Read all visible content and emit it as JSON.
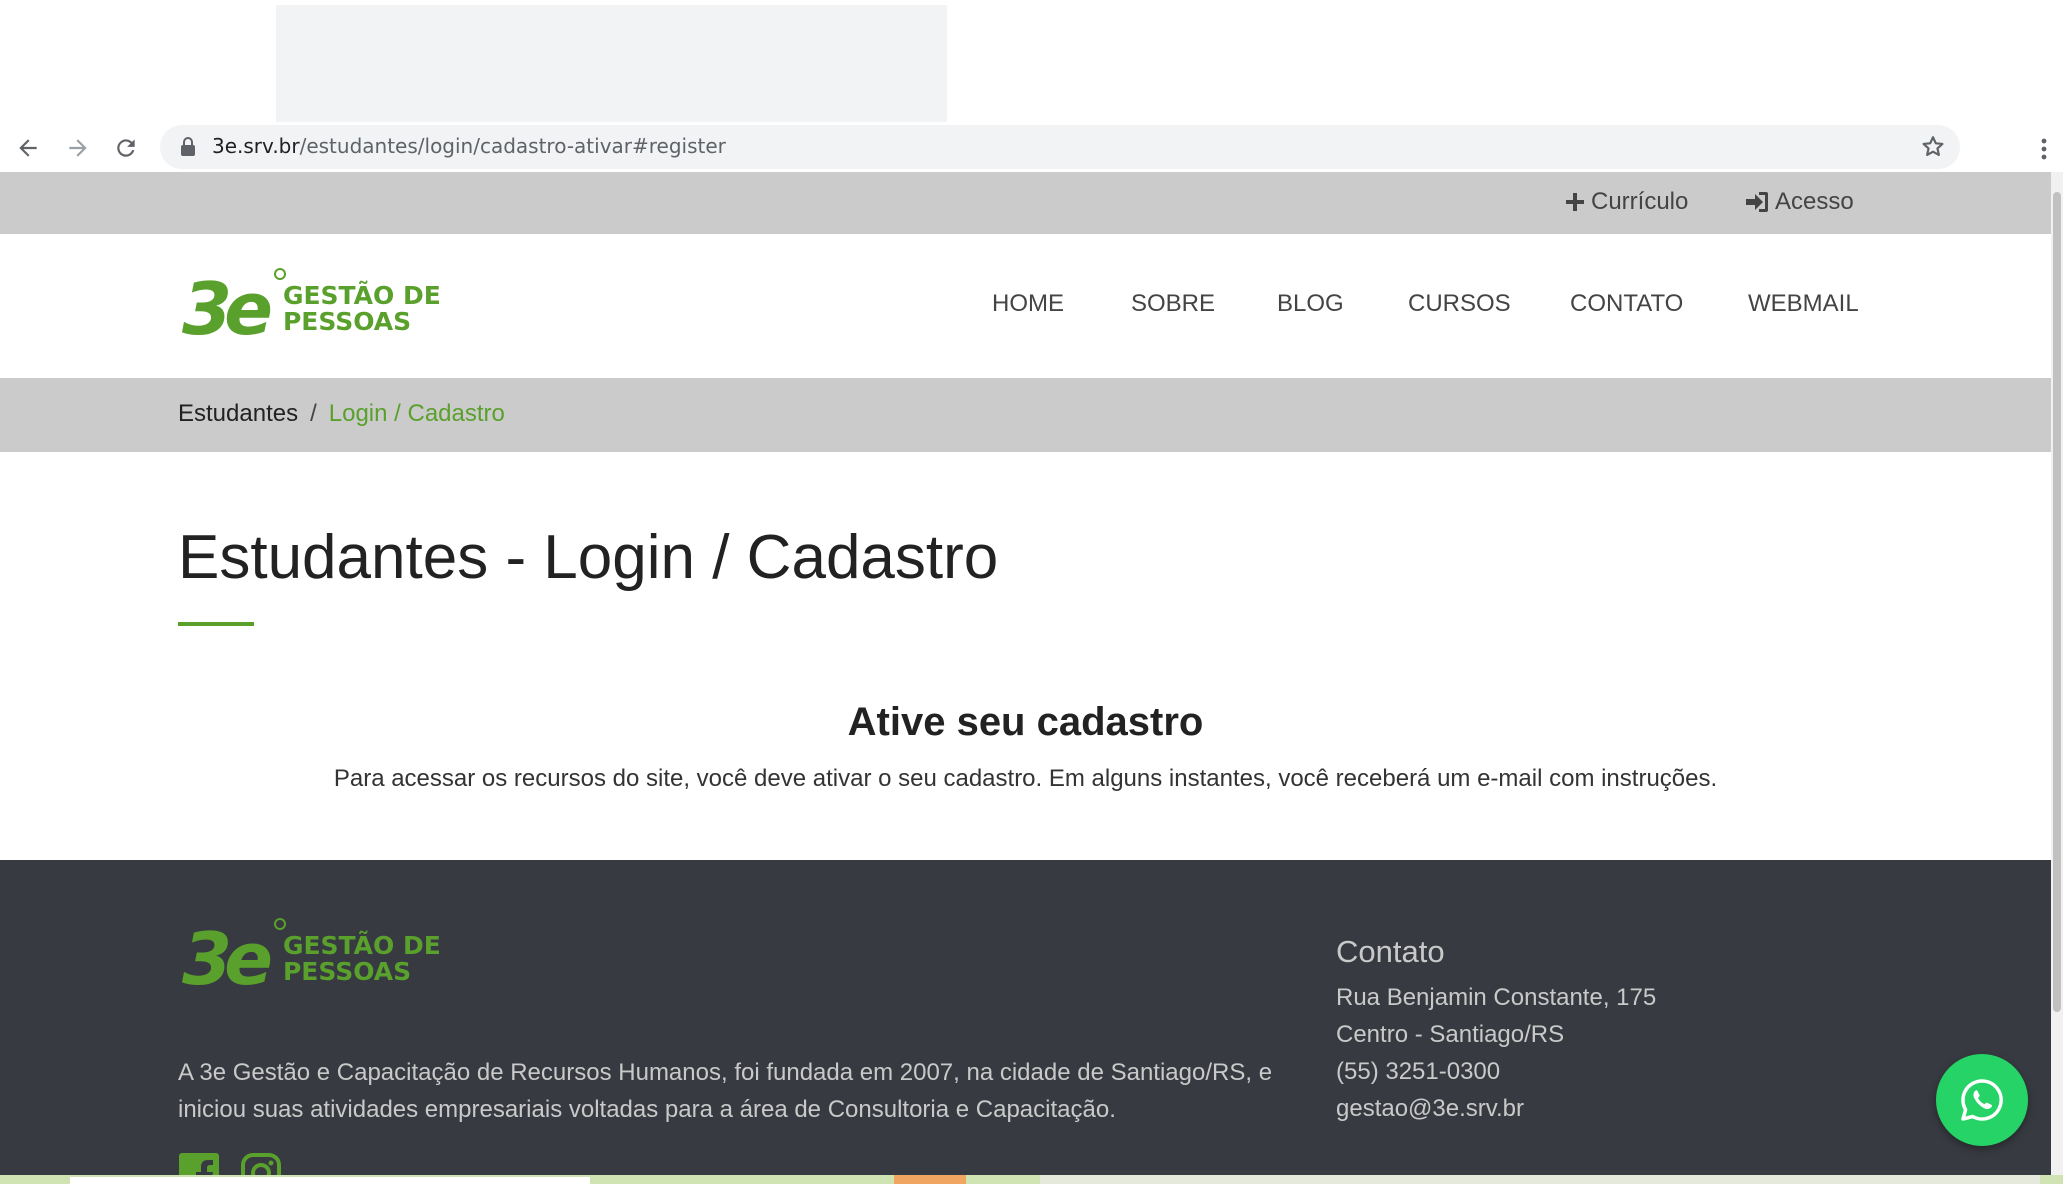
{
  "browser": {
    "url_host": "3e.srv.br",
    "url_path": "/estudantes/login/cadastro-ativar#register"
  },
  "topbar": {
    "curriculo_label": "Currículo",
    "acesso_label": "Acesso"
  },
  "brand": {
    "logo_mark": "3e",
    "logo_line1": "GESTÃO DE",
    "logo_line2": "PESSOAS",
    "green": "#5aa02c"
  },
  "nav": {
    "items": [
      "HOME",
      "SOBRE",
      "BLOG",
      "CURSOS",
      "CONTATO",
      "WEBMAIL"
    ]
  },
  "breadcrumb": {
    "root": "Estudantes",
    "separator": "/",
    "current": "Login / Cadastro"
  },
  "main": {
    "title": "Estudantes - Login / Cadastro",
    "activate_title": "Ative seu cadastro",
    "activate_text": "Para acessar os recursos do site, você deve ativar o seu cadastro. Em alguns instantes, você receberá um e-mail com instruções."
  },
  "footer": {
    "about": "A 3e Gestão e Capacitação de Recursos Humanos, foi fundada em 2007, na cidade de Santiago/RS, e iniciou suas atividades empresariais voltadas para a área de Consultoria e Capacitação.",
    "contact_title": "Contato",
    "address_line1": "Rua Benjamin Constante, 175",
    "address_line2": "Centro - Santiago/RS",
    "phone": "(55) 3251-0300",
    "email": "gestao@3e.srv.br",
    "social_icons": [
      "facebook-icon",
      "instagram-icon"
    ]
  },
  "colors": {
    "topbar_bg": "#cbcbcb",
    "footer_bg": "#373a40",
    "whatsapp": "#25d366"
  }
}
